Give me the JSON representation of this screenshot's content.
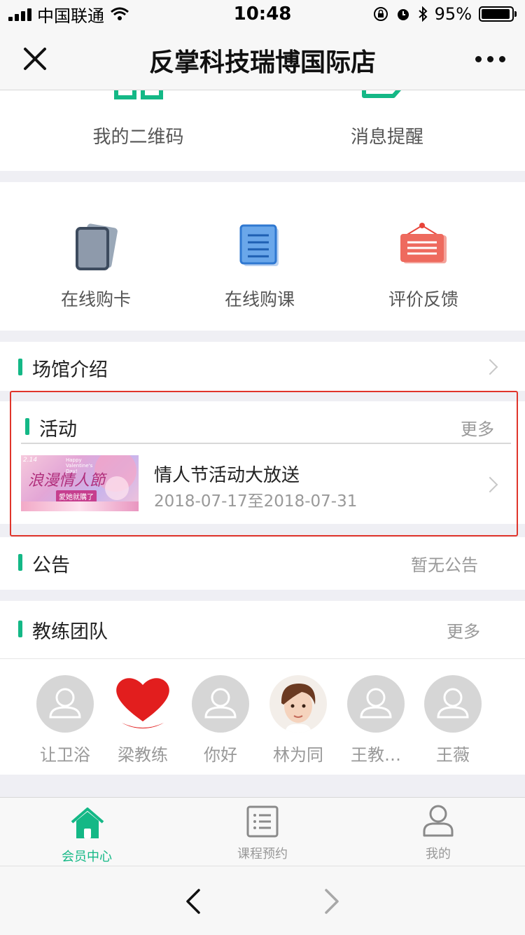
{
  "status": {
    "carrier": "中国联通",
    "time": "10:48",
    "battery": "95%"
  },
  "nav": {
    "title": "反掌科技瑞博国际店"
  },
  "top_tiles": [
    {
      "label": "我的二维码",
      "icon": "qrcode-icon"
    },
    {
      "label": "消息提醒",
      "icon": "message-icon"
    }
  ],
  "services": [
    {
      "label": "在线购卡",
      "icon": "card-icon"
    },
    {
      "label": "在线购课",
      "icon": "course-icon"
    },
    {
      "label": "评价反馈",
      "icon": "feedback-icon"
    }
  ],
  "venue": {
    "title": "场馆介绍"
  },
  "activity": {
    "title": "活动",
    "more": "更多",
    "item": {
      "name": "情人节活动大放送",
      "dates": "2018-07-17至2018-07-31",
      "banner_big": "浪漫情人節",
      "banner_sub": "愛她就購了",
      "banner_en": "Happy Valentine's Day!",
      "banner_date": "2.14"
    }
  },
  "notice": {
    "title": "公告",
    "status": "暂无公告"
  },
  "coaches": {
    "title": "教练团队",
    "more": "更多",
    "list": [
      {
        "name": "让卫浴",
        "avatar": "default"
      },
      {
        "name": "梁教练",
        "avatar": "heart"
      },
      {
        "name": "你好",
        "avatar": "default"
      },
      {
        "name": "林为同",
        "avatar": "photo"
      },
      {
        "name": "王教…",
        "avatar": "default"
      },
      {
        "name": "王薇",
        "avatar": "default"
      }
    ]
  },
  "tabbar": [
    {
      "label": "会员中心",
      "active": true
    },
    {
      "label": "课程预约",
      "active": false
    },
    {
      "label": "我的",
      "active": false
    }
  ],
  "colors": {
    "accent": "#14b886",
    "highlight_border": "#e0352b"
  }
}
